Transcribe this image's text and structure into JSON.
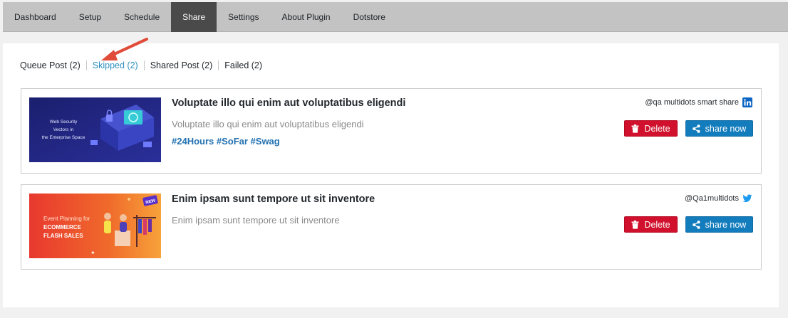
{
  "nav": {
    "tabs": [
      {
        "label": "Dashboard"
      },
      {
        "label": "Setup"
      },
      {
        "label": "Schedule"
      },
      {
        "label": "Share",
        "active": true
      },
      {
        "label": "Settings"
      },
      {
        "label": "About Plugin"
      },
      {
        "label": "Dotstore"
      }
    ]
  },
  "subnav": {
    "items": [
      {
        "label": "Queue Post (2)"
      },
      {
        "label": "Skipped (2)",
        "current": true
      },
      {
        "label": "Shared Post (2)"
      },
      {
        "label": "Failed (2)"
      }
    ]
  },
  "posts": [
    {
      "title": "Voluptate illo qui enim aut voluptatibus eligendi",
      "text": "Voluptate illo qui enim aut voluptatibus eligendi",
      "hashtags": "#24Hours #SoFar #Swag",
      "account": "@qa multidots smart share",
      "network_icon": "linkedin-icon",
      "thumbnail_text": [
        "Web Security",
        "Vectors in",
        "the Enterprise Space"
      ],
      "delete_label": "Delete",
      "share_label": "share now"
    },
    {
      "title": "Enim ipsam sunt tempore ut sit inventore",
      "text": "Enim ipsam sunt tempore ut sit inventore",
      "hashtags": "",
      "account": "@Qa1multidots",
      "network_icon": "twitter-icon",
      "thumbnail_text": [
        "Event Planning for",
        "ECOMMERCE",
        "FLASH SALES",
        "NEW"
      ],
      "delete_label": "Delete",
      "share_label": "share now"
    }
  ],
  "colors": {
    "accent": "#2c8fbf",
    "delete": "#d0102c",
    "share": "#137cbd",
    "arrow": "#e04b3a",
    "nav_active": "#4a4a4a"
  }
}
